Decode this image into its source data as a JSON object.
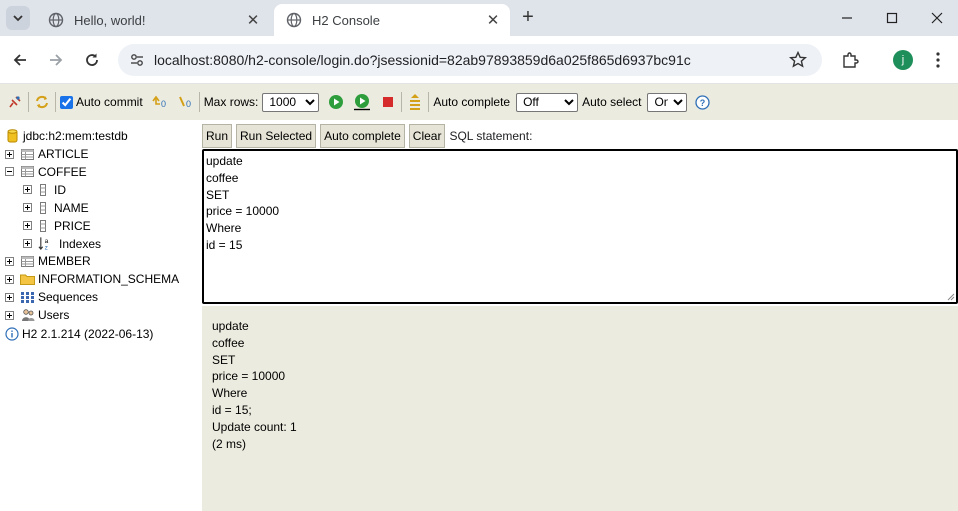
{
  "browser": {
    "tabs": [
      {
        "title": "Hello, world!",
        "active": false
      },
      {
        "title": "H2 Console",
        "active": true
      }
    ],
    "url": "localhost:8080/h2-console/login.do?jsessionid=82ab97893859d6a025f865d6937bc91c",
    "profile_initial": "j"
  },
  "h2_toolbar": {
    "auto_commit_label": "Auto commit",
    "auto_commit_checked": true,
    "max_rows_label": "Max rows:",
    "max_rows_value": "1000",
    "auto_complete_label": "Auto complete",
    "auto_complete_value": "Off",
    "auto_select_label": "Auto select",
    "auto_select_value": "On"
  },
  "tree": {
    "connection": "jdbc:h2:mem:testdb",
    "items": [
      {
        "label": "ARTICLE",
        "kind": "table",
        "level": 0,
        "toggle": "closed"
      },
      {
        "label": "COFFEE",
        "kind": "table",
        "level": 0,
        "toggle": "open"
      },
      {
        "label": "ID",
        "kind": "column",
        "level": 1,
        "toggle": "closed"
      },
      {
        "label": "NAME",
        "kind": "column",
        "level": 1,
        "toggle": "closed"
      },
      {
        "label": "PRICE",
        "kind": "column",
        "level": 1,
        "toggle": "closed"
      },
      {
        "label": "Indexes",
        "kind": "index",
        "level": 1,
        "toggle": "closed"
      },
      {
        "label": "MEMBER",
        "kind": "table",
        "level": 0,
        "toggle": "closed"
      },
      {
        "label": "INFORMATION_SCHEMA",
        "kind": "folder",
        "level": 0,
        "toggle": "closed"
      },
      {
        "label": "Sequences",
        "kind": "sequence",
        "level": 0,
        "toggle": "closed"
      },
      {
        "label": "Users",
        "kind": "users",
        "level": 0,
        "toggle": "closed"
      }
    ],
    "version": "H2 2.1.214 (2022-06-13)"
  },
  "query": {
    "buttons": [
      "Run",
      "Run Selected",
      "Auto complete",
      "Clear"
    ],
    "sql_label": "SQL statement:",
    "sql_lines": [
      "update",
      "coffee",
      "SET",
      "price = 10000",
      "Where",
      "id = 15"
    ]
  },
  "result": {
    "lines": [
      "update",
      "coffee",
      "SET",
      "price = 10000",
      "Where",
      "id = 15;",
      "Update count: 1",
      "(2 ms)"
    ]
  }
}
